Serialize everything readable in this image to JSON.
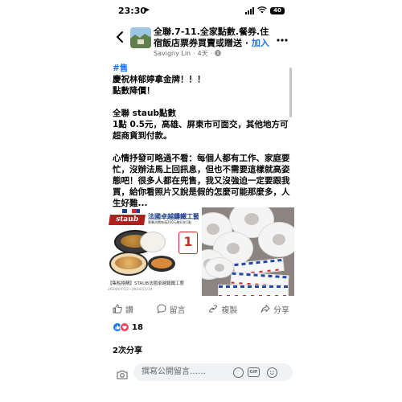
{
  "status_bar": {
    "time": "23:30",
    "location_arrow": "➤",
    "battery": "40"
  },
  "header": {
    "back_icon": "chevron-left-icon",
    "title": "全聯.7-11.全家點數.餐券.住宿飯店票券買賣或贈送",
    "join_separator": " · ",
    "join_label": "加入",
    "author": "Savigny Lin",
    "time": "4天",
    "privacy_icon": "globe-icon",
    "more_icon": "more-horizontal-icon"
  },
  "post": {
    "hashtag": "#售",
    "lines": [
      "慶祝林郁婷拿金牌！！！",
      "點數降價！",
      "",
      "全聯 staub點數",
      "1點 0.5元，高雄、屏東市可面交，其他地方可超商貨到付款。",
      "",
      "心情抒發可略過不看：每個人都有工作、家庭要忙，沒辦法馬上回訊息，但也不需要這樣就高姿態吧！很多人都在兜售，我又沒強迫一定要跟我買，給你看照片又說是假的怎麼可能那麼多，人生好難..."
    ]
  },
  "media": {
    "left": {
      "brand": "staub",
      "title": "法國卓越鑄鐵工藝",
      "subtitle": "單筆消費每滿200元贈印花1點",
      "badge": "1",
      "caption": "【集點換購】STAUB法國卓越鑄鐵工藝",
      "date": "2024/07/12~2024/11/14"
    }
  },
  "actions": [
    {
      "label": "讚",
      "icon": "thumbs-up-icon"
    },
    {
      "label": "留言",
      "icon": "comment-icon"
    },
    {
      "label": "複製",
      "icon": "copy-icon"
    },
    {
      "label": "分享",
      "icon": "share-icon"
    }
  ],
  "reactions": {
    "count": "18",
    "icons": [
      "like-icon",
      "love-icon"
    ]
  },
  "shares": "2次分享",
  "composer": {
    "placeholder": "撰寫公開留言……",
    "camera_icon": "camera-icon",
    "gif_label": "GIF"
  },
  "colors": {
    "accent": "#1877f2",
    "love": "#f33e58",
    "secondary_text": "#65676b",
    "input_bg": "#f0f2f5"
  }
}
